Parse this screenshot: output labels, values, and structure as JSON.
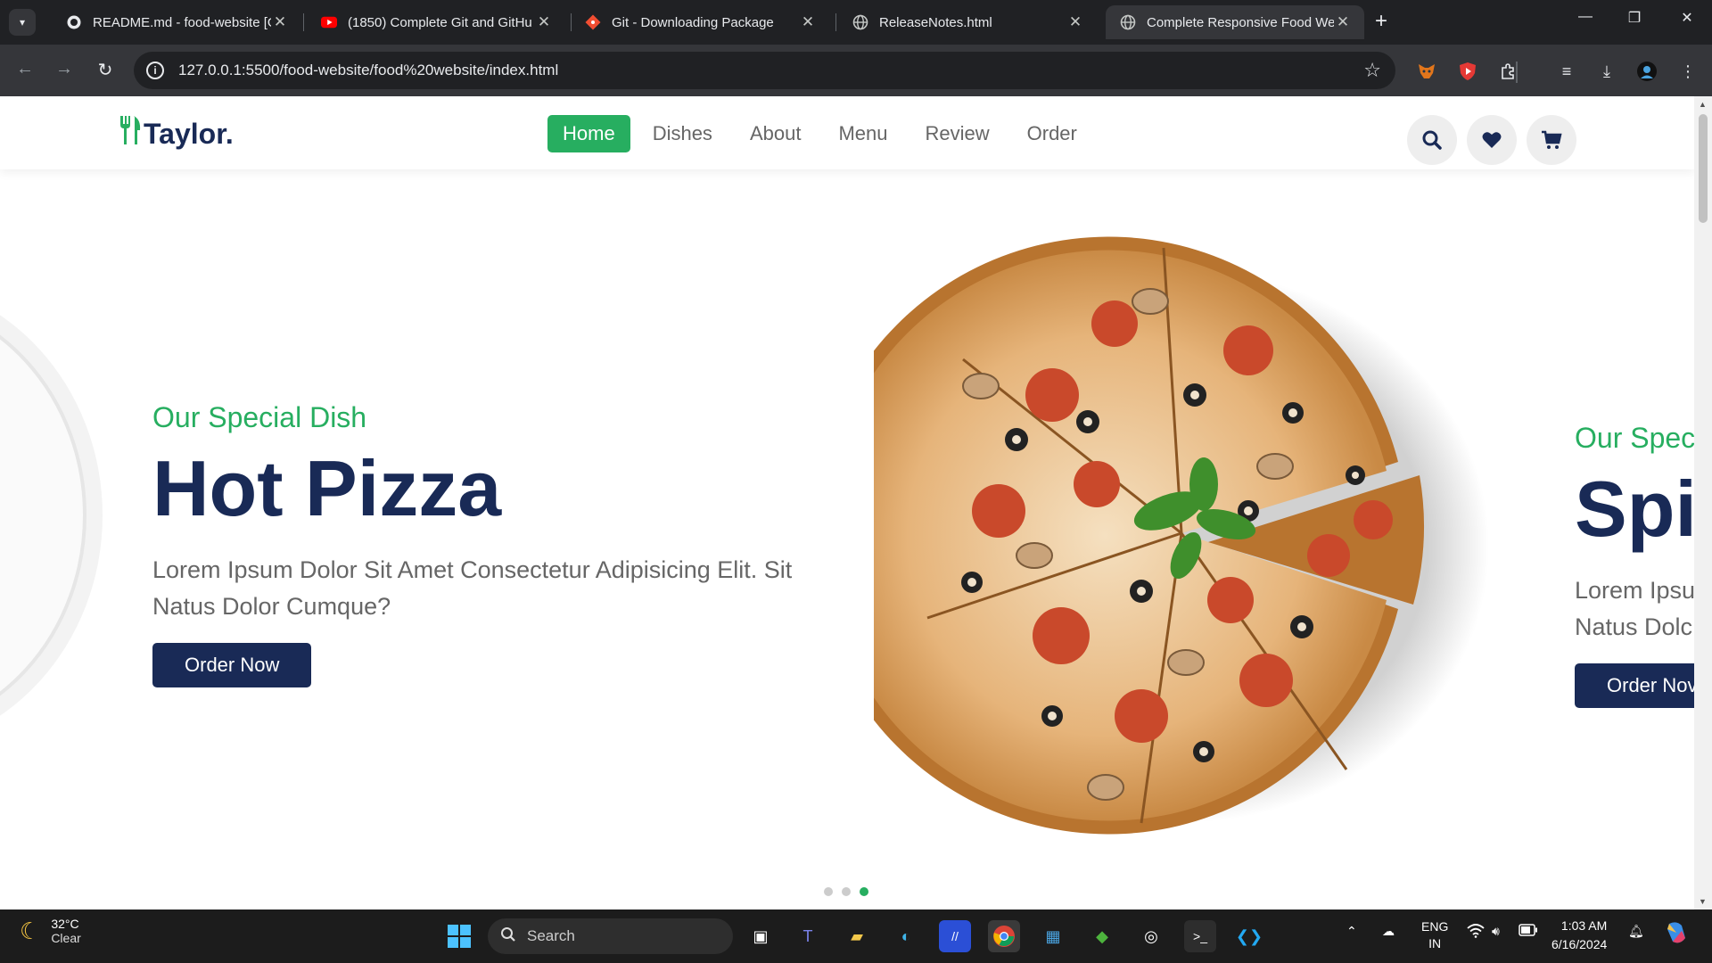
{
  "browser": {
    "tabs": [
      {
        "title": "README.md - food-website [Gi",
        "icon": "github-icon"
      },
      {
        "title": "(1850) Complete Git and GitHu",
        "icon": "youtube-icon"
      },
      {
        "title": "Git - Downloading Package",
        "icon": "git-icon"
      },
      {
        "title": "ReleaseNotes.html",
        "icon": "globe-icon"
      },
      {
        "title": "Complete Responsive Food Wel",
        "icon": "globe-icon"
      }
    ],
    "url": "127.0.0.1:5500/food-website/food%20website/index.html"
  },
  "site": {
    "logo_text": "Taylor.",
    "nav": [
      "Home",
      "Dishes",
      "About",
      "Menu",
      "Review",
      "Order"
    ],
    "active_nav": "Home",
    "slides": [
      {
        "subtitle": "Our Special Dish",
        "title": "Hot Pizza",
        "description": "Lorem Ipsum Dolor Sit Amet Consectetur Adipisicing Elit. Sit Natus Dolor Cumque?",
        "button": "Order Now"
      },
      {
        "subtitle": "Our Speci",
        "title": "Spi",
        "description_line1": "Lorem Ipsu",
        "description_line2": "Natus Dolc",
        "button": "Order Nov"
      }
    ],
    "slider_dots": 3,
    "active_dot": 3
  },
  "taskbar": {
    "weather_temp": "32°C",
    "weather_cond": "Clear",
    "search_placeholder": "Search",
    "lang1": "ENG",
    "lang2": "IN",
    "time": "1:03 AM",
    "date": "6/16/2024"
  },
  "colors": {
    "brand_green": "#27ae60",
    "brand_navy": "#192a56"
  }
}
